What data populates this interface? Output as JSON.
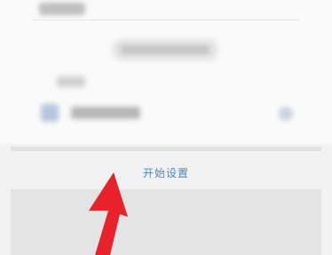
{
  "main": {
    "start_label": "开始设置"
  },
  "colors": {
    "accent": "#4a87c5",
    "arrow": "#e8212a"
  },
  "icons": {
    "annotation": "red-arrow-icon"
  }
}
